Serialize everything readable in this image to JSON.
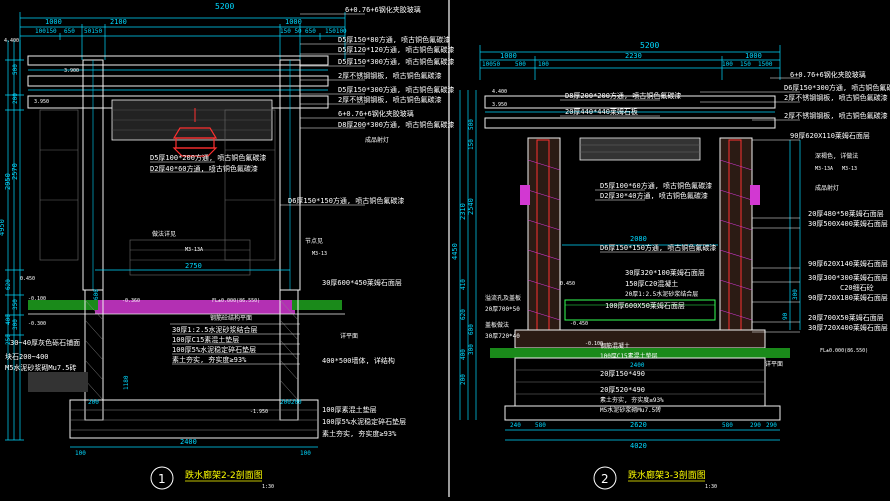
{
  "colors": {
    "background": "#000000",
    "dimension": "#00d8ff",
    "annotation": "#ffffff",
    "structure": "#f0f0f0",
    "magenta": "#ff40ff",
    "green": "#33ff55",
    "red": "#ff3030",
    "yellow": "#ffff00",
    "caption": "#ffff00"
  },
  "left_section": {
    "title": "跌水廊架2-2剖面图",
    "scale": "1:30",
    "number": "1",
    "top_dims": [
      "5200",
      "1000",
      "2100",
      "1000",
      "100150",
      "650",
      "50150",
      "150 50",
      "650",
      "150100"
    ],
    "vertical_dims": [
      "4950",
      "2950",
      "2570",
      "500",
      "200",
      "350",
      "300",
      "620",
      "400",
      "250",
      "600",
      "1180"
    ],
    "bottom_dims": [
      "2400",
      "2750",
      "200200",
      "100",
      "100",
      "200"
    ],
    "callouts": [
      "6+0.76+6钢化夹胶玻璃",
      "D5厚150*80方通, 喷古铜色氟碳漆",
      "D5厚120*120方通, 喷古铜色氟碳漆",
      "D5厚150*300方通, 喷古铜色氟碳漆",
      "2厚不锈钢钢板, 喷古铜色氟碳漆",
      "D5厚150*300方通, 喷古铜色氟碳漆",
      "2厚不锈钢钢板, 喷古铜色氟碳漆",
      "6+0.76+6钢化夹胶玻璃",
      "D8厚200*300方通, 喷古铜色氟碳漆",
      "成品射灯",
      "D5厚100*200方通, 喷古铜色氟碳漆",
      "D2厚40*60方通, 喷古铜色氟碳漆",
      "D6厚150*150方通, 喷古铜色氟碳漆",
      "做法详见",
      "节点见",
      "30厚600*450莱姆石面层",
      "30~40厚灰色砾石铺面",
      "块石200~400",
      "M5水泥砂浆砌Mu7.5砖",
      "钢筋砼结构平面",
      "30厚1:2.5水泥砂浆结合层",
      "100厚C15素混土垫层",
      "100厚5%水泥稳定碎石垫层",
      "素土夯实, 夯实度≥93%",
      "400*500墙体, 详结构",
      "100厚素混土垫层",
      "100厚5%水泥稳定碎石垫层",
      "素土夯实, 夯实度≥93%",
      "详平面",
      "M3-13A",
      "M3-13"
    ],
    "levels": [
      "4.400",
      "3.900",
      "3.950",
      "0.450",
      "-0.100",
      "-0.300",
      "-0.360",
      "-1.950",
      "FL±0.000(86.550)"
    ]
  },
  "right_section": {
    "title": "跌水廊架3-3剖面图",
    "scale": "1:30",
    "number": "2",
    "top_dims": [
      "5200",
      "2230",
      "1000",
      "1000",
      "10050",
      "500",
      "100",
      "1500",
      "100",
      "150"
    ],
    "vertical_dims": [
      "4450",
      "2310",
      "2540",
      "620",
      "410",
      "150",
      "600",
      "300",
      "400",
      "200",
      "500",
      "300",
      "90"
    ],
    "bottom_dims": [
      "240",
      "580",
      "2620",
      "580",
      "290",
      "290",
      "4020",
      "2080",
      "2400"
    ],
    "callouts": [
      "6+0.76+6钢化夹胶玻璃",
      "D6厚150*300方通, 喷古铜色氟碳漆",
      "2厚不锈钢钢板, 喷古铜色氟碳漆",
      "D8厚200*200方通, 喷古铜色氟碳漆",
      "20厚440*440莱姆石板",
      "2厚不锈钢钢板, 喷古铜色氟碳漆",
      "90厚620X110莱姆石面层",
      "深褐色, 详做法",
      "成品射灯",
      "D5厚100*60方通, 喷古铜色氟碳漆",
      "D2厚30*40方通, 喷古铜色氟碳漆",
      "D6厚150*150方通, 喷古铜色氟碳漆",
      "20厚480*50莱姆石面层",
      "30厚500X400莱姆石面层",
      "90厚620X140莱姆石面层",
      "30厚300*300莱姆石面层",
      "C20细石砼",
      "90厚720X180莱姆石面层",
      "20厚700X50莱姆石面层",
      "30厚720X400莱姆石面层",
      "30厚320*100莱姆石面层",
      "150厚C20混凝土",
      "20厚1:2.5水泥砂浆结合层",
      "100厚600X50莱姆石面层",
      "溢流孔及盖板",
      "20厚700*50",
      "盖板做法",
      "30厚720*40",
      "钢筋混凝土",
      "100厚C15素混土垫层",
      "20厚150*490",
      "20厚520*490",
      "素土夯实, 夯实度≥93%",
      "M5水泥砂浆砌Mu7.5砖",
      "详平面",
      "M3-13A",
      "M3-13"
    ],
    "levels": [
      "4.400",
      "3.950",
      "-0.450",
      "-0.100",
      "0.450",
      "FL±0.000(86.550)"
    ]
  }
}
